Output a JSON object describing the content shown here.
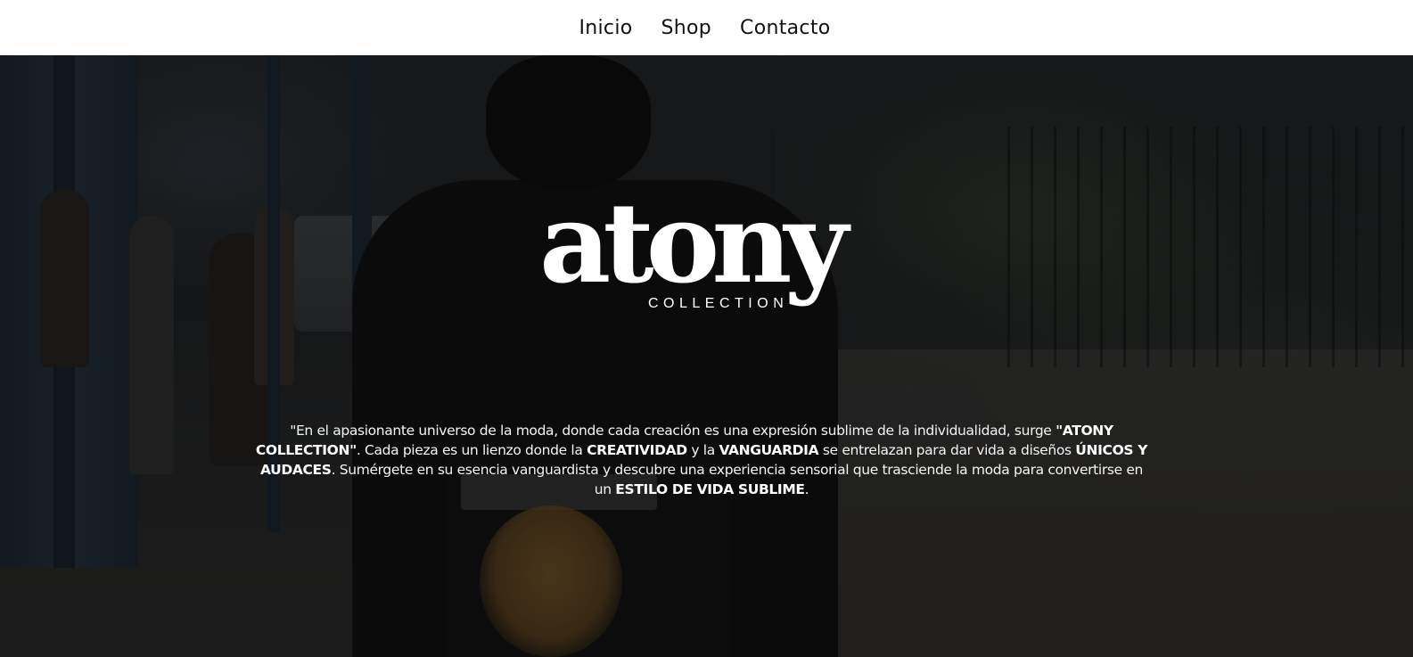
{
  "nav": {
    "items": [
      {
        "label": "Inicio"
      },
      {
        "label": "Shop"
      },
      {
        "label": "Contacto"
      }
    ]
  },
  "hero": {
    "logo": {
      "wordmark": "atony",
      "subtitle": "COLLECTION"
    },
    "intro": {
      "p1": "\"En el apasionante universo de la moda, donde cada creación es una expresión sublime de la individualidad, surge ",
      "b1": "\"ATONY COLLECTION\"",
      "p2": ". Cada pieza es un lienzo donde la ",
      "b2": "CREATIVIDAD",
      "p3": " y la ",
      "b3": "VANGUARDIA",
      "p4": " se entrelazan para dar vida a diseños ",
      "b4": "ÚNICOS Y AUDACES",
      "p5": ". Sumérgete en su esencia vanguardista y descubre una experiencia sensorial que trasciende la moda para convertirse en un ",
      "b5": "ESTILO DE VIDA SUBLIME",
      "p6": "."
    }
  },
  "colors": {
    "nav_background": "#ffffff",
    "nav_text": "#111111",
    "hero_text": "#ffffff"
  }
}
